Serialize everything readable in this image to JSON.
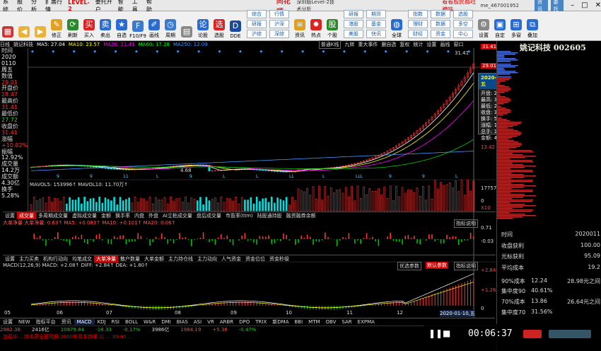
{
  "menu": {
    "items": [
      "系统",
      "报价",
      "分析",
      "扩展行情",
      "LEVEL-2",
      "委托开户",
      "智能",
      "工具",
      "帮助"
    ],
    "app_name": "同花顺",
    "version": "深圳版Level-2技术分析",
    "ad": "看看股民都吐槽啥",
    "user": "me_467001952",
    "btn1": "资讯",
    "btn2": "委托"
  },
  "toolbar": {
    "buttons": [
      "",
      "",
      "",
      "修正",
      "刷新",
      "买入",
      "卖出",
      "自选",
      "F10/F9",
      "画线",
      "周期",
      "",
      "论股",
      "选股",
      "DDE",
      "F10",
      "资讯",
      "热点",
      "个股",
      "新闻",
      "板块",
      "综合",
      "全球",
      "设置",
      "自定",
      "多窗",
      "叠加"
    ],
    "small": [
      "综合",
      "研报",
      "沪综",
      "行情",
      "沪深",
      "深综",
      "研报",
      "港股",
      "美股",
      "期货",
      "基金",
      "快讯",
      "指数",
      "理财",
      "财经",
      "数据",
      "数据",
      "资金",
      "选股",
      "多空",
      "中心"
    ]
  },
  "stock": {
    "short": "姚记科技",
    "name_code": "姚记科技 002605",
    "ma": [
      {
        "label": "MA5: 27.04",
        "color": "#ffffff"
      },
      {
        "label": "MA10: 23.57",
        "color": "#ffff00"
      },
      {
        "label": "MA20: 21.41",
        "color": "#ff00ff"
      },
      {
        "label": "MA60: 17.28",
        "color": "#00ff00"
      },
      {
        "label": "MA250: 12.09",
        "color": "#4499ff"
      }
    ],
    "mode_label": "普通K线",
    "toolbar2": [
      "九转",
      "重大事件",
      "删自选",
      "复权",
      "统计",
      "设置",
      "画线",
      "窗口"
    ]
  },
  "leftpanel": [
    {
      "t": "时间",
      "c": "lbl"
    },
    {
      "t": "2020",
      "c": "wht"
    },
    {
      "t": "0110",
      "c": "wht"
    },
    {
      "t": "周五",
      "c": "wht"
    },
    {
      "t": "数值",
      "c": "lbl"
    },
    {
      "t": "29.01",
      "c": "red"
    },
    {
      "t": "开盘价",
      "c": "lbl"
    },
    {
      "t": "28.47",
      "c": "red"
    },
    {
      "t": "最高价",
      "c": "lbl"
    },
    {
      "t": "31.41",
      "c": "red"
    },
    {
      "t": "最低价",
      "c": "lbl"
    },
    {
      "t": "27.72",
      "c": "grn"
    },
    {
      "t": "收盘价",
      "c": "lbl"
    },
    {
      "t": "31.41",
      "c": "red"
    },
    {
      "t": "涨幅",
      "c": "lbl"
    },
    {
      "t": "+10.02%",
      "c": "red"
    },
    {
      "t": "振幅",
      "c": "lbl"
    },
    {
      "t": "12.92%",
      "c": "wht"
    },
    {
      "t": "成交量",
      "c": "lbl"
    },
    {
      "t": "14.2万",
      "c": "wht"
    },
    {
      "t": "成交额",
      "c": "lbl"
    },
    {
      "t": "4.30亿",
      "c": "wht"
    },
    {
      "t": "换手",
      "c": "lbl"
    },
    {
      "t": "5.28%",
      "c": "wht"
    }
  ],
  "kline": {
    "price_max": "31.41",
    "price_min": "4.68",
    "label_29": "29.01",
    "label_13": "13.42",
    "x_labels": [
      "9",
      "9",
      "11",
      "L",
      "9",
      "L",
      "L",
      "LL",
      "L",
      "LLL",
      "9",
      "9",
      "L"
    ]
  },
  "tooltip": {
    "date": "2020-01-10,五",
    "rows": [
      "开盘: 28.47",
      "最高: 31.41",
      "最低: 27.72",
      "收盘: 31.41",
      "换手: 5.28%",
      "涨幅: 10.02%",
      "总手: 14.2万",
      "金额: 4.3亿"
    ]
  },
  "volume": {
    "label": "MAVOL5: 153996↑ MAVOL10: 11.70万↑",
    "ticks": [
      "17757",
      "0",
      "X10"
    ]
  },
  "tabs1": [
    "设置",
    "成交量",
    "多周期成交量",
    "虚拟成交量",
    "金额",
    "换手率",
    "内盘",
    "外盘",
    "AI立桩成交量",
    "盘后成交量",
    "市盈率(ttm)",
    "陆股通持股",
    "融资融券余额"
  ],
  "tabs1_active": 1,
  "bigorder": {
    "label": "大单净量  大单净量: 0.63↑ MA5: +0.083↑ MA10: +0.101↑ MA20: 0.06↑",
    "btn": "指标说明",
    "ticks": [
      "0.71",
      "-0.03",
      "0"
    ]
  },
  "tabs2": [
    "设置",
    "主力买卖",
    "机构行动向",
    "均笔成交",
    "大单净量",
    "散户数量",
    "大单金额",
    "主力持仓线",
    "主力动向",
    "人气资金",
    "资金位位",
    "资金秒级"
  ],
  "tabs2_active": 4,
  "macd": {
    "label": "MACD(12,26,9)  MACD: +2.08↑ DIFF: +2.84↑ DEA: +1.80↑",
    "btn1": "优选参数",
    "btn2": "默认参数",
    "btn3": "指标说明",
    "ticks": [
      "+2.84",
      "+1.26",
      "0"
    ],
    "dates": [
      "05",
      "06",
      "07",
      "08",
      "09",
      "10",
      "11",
      "12",
      "2020-01-10,五"
    ]
  },
  "bottomtabs": [
    "设置",
    "NEW",
    "指标平台",
    "资讯",
    "MACD",
    "KDJ",
    "RSI",
    "BOLL",
    "W&R",
    "DMI",
    "BIAS",
    "ASI",
    "VR",
    "ARBR",
    "DPO",
    "TRIX",
    "新DMA",
    "BBI",
    "MTM",
    "OBV",
    "SAR",
    "EXPMA"
  ],
  "bottomtabs_active": 4,
  "ticker": [
    "2982.38",
    "+?.??",
    "2416亿",
    "10879.84",
    "-18.33",
    "-0.17%",
    "3986亿",
    "1984.19",
    "+5.38",
    "-0.47%"
  ],
  "news": "加载中... 持本获全面同期 2000年月本持续 以 ...  30:40 ...",
  "rightpanel": {
    "rows": [
      {
        "k": "时间",
        "v": "",
        "v2": "2020011"
      },
      {
        "k": "收盘获利",
        "v": "",
        "v2": "100.00"
      },
      {
        "k": "光标获利",
        "v": "",
        "v2": "95.09"
      },
      {
        "k": "平均成本",
        "v": "",
        "v2": "19.2"
      },
      {
        "k": "90%成本",
        "v": "12.24",
        "v2": "28.98元之间"
      },
      {
        "k": "集中度90",
        "v": "40.61%",
        "v2": ""
      },
      {
        "k": "70%成本",
        "v": "13.86",
        "v2": "26.64元之间"
      },
      {
        "k": "集中度70",
        "v": "31.56%",
        "v2": ""
      }
    ]
  },
  "video": {
    "time": "00:06:37"
  }
}
